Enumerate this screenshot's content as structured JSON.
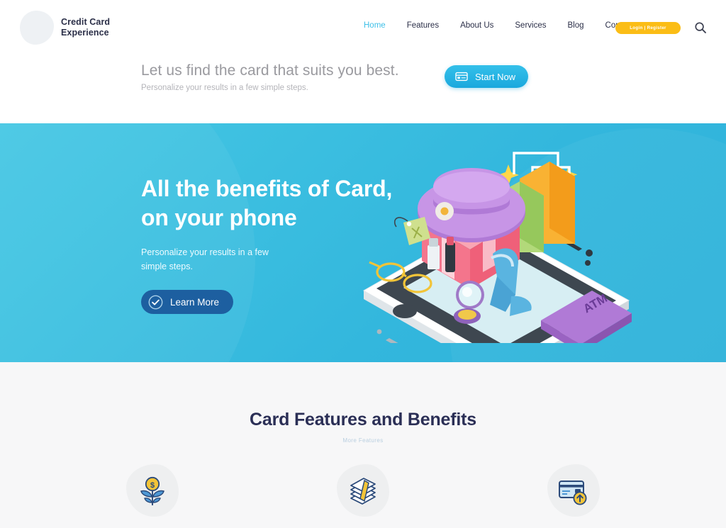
{
  "brand": {
    "line1": "Credit Card",
    "line2": "Experience",
    "logo_icon": "phone-credit-card-icon"
  },
  "nav": {
    "items": [
      {
        "label": "Home",
        "active": true
      },
      {
        "label": "Features",
        "active": false
      },
      {
        "label": "About Us",
        "active": false
      },
      {
        "label": "Services",
        "active": false
      },
      {
        "label": "Blog",
        "active": false
      },
      {
        "label": "Contacts",
        "active": false
      }
    ],
    "login_label": "Login | Register",
    "search_icon": "search-icon"
  },
  "subhero": {
    "title": "Let us find the card that suits you best.",
    "subtitle": "Personalize your results in a few simple steps.",
    "cta_label": "Start Now",
    "cta_icon": "credit-card-icon"
  },
  "hero": {
    "title_line1": "All the benefits of Card,",
    "title_line2": "on your phone",
    "subtitle_line1": "Personalize your results in a few",
    "subtitle_line2": "simple steps.",
    "cta_label": "Learn More",
    "cta_icon": "check-circle-icon",
    "illustration": "isometric-phone-shopping-items-atm-card",
    "bg_color": "#33b7dd",
    "cta_color": "#1d5fa0"
  },
  "features": {
    "title": "Card Features and Benefits",
    "subtitle": "More Features",
    "items": [
      {
        "icon": "money-plant-icon"
      },
      {
        "icon": "cash-stack-icon"
      },
      {
        "icon": "credit-card-up-arrow-icon"
      }
    ]
  },
  "colors": {
    "accent_cyan": "#3fc0e8",
    "accent_yellow": "#fbbd16",
    "dark_navy": "#2b2f56",
    "page_bg": "#f7f7f8"
  }
}
